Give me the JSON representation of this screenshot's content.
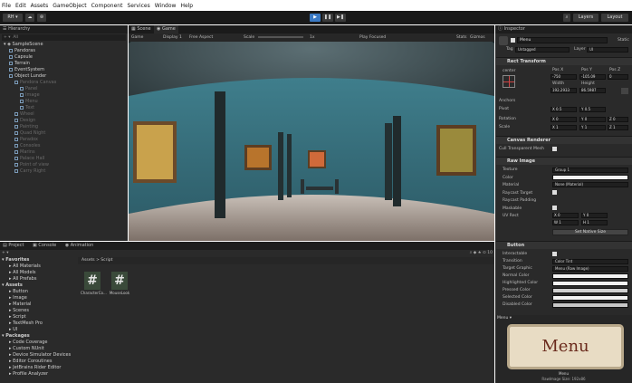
{
  "menubar": [
    "File",
    "Edit",
    "Assets",
    "GameObject",
    "Component",
    "Services",
    "Window",
    "Help"
  ],
  "toolbar": {
    "account": "RH ▾",
    "cloud": "☁",
    "play": "▶",
    "pause": "❚❚",
    "step": "▶❚",
    "layers": "Layers",
    "layout": "Layout"
  },
  "hierarchy": {
    "tab": "Hierarchy",
    "search_placeholder": "All",
    "scene": "SampleScene",
    "items": [
      {
        "label": "Pandoras",
        "dim": false
      },
      {
        "label": "Capsule",
        "dim": false
      },
      {
        "label": "Terrain",
        "dim": false
      },
      {
        "label": "EventSystem",
        "dim": false
      },
      {
        "label": "Object Lunder",
        "dim": false
      },
      {
        "label": "Pandora Canvas",
        "dim": true
      },
      {
        "label": "Panel",
        "dim": true
      },
      {
        "label": "Image",
        "dim": true
      },
      {
        "label": "Menu",
        "dim": true
      },
      {
        "label": "Text",
        "dim": true
      },
      {
        "label": "Wheel",
        "dim": true
      },
      {
        "label": "Design",
        "dim": true
      },
      {
        "label": "Painting",
        "dim": true
      },
      {
        "label": "Quad Night",
        "dim": true
      },
      {
        "label": "Paradox",
        "dim": true
      },
      {
        "label": "Consoles",
        "dim": true
      },
      {
        "label": "Marins",
        "dim": true
      },
      {
        "label": "Palace Hall",
        "dim": true
      },
      {
        "label": "Point of view",
        "dim": true
      },
      {
        "label": "Carry Right",
        "dim": true
      }
    ]
  },
  "scene_view": {
    "tabs": [
      "Scene",
      "Game"
    ],
    "game_bar": {
      "display": "Game",
      "display_no": "Display 1",
      "aspect": "Free Aspect",
      "scale": "Scale",
      "scale_value": "1x",
      "play_focused": "Play Focused",
      "stats": "Stats",
      "gizmos": "Gizmos"
    }
  },
  "project": {
    "tabs": [
      "Project",
      "Console",
      "Animation"
    ],
    "favorites_title": "Favorites",
    "favorites": [
      "All Materials",
      "All Models",
      "All Prefabs"
    ],
    "assets_title": "Assets",
    "assets": [
      "Button",
      "Image",
      "Material",
      "Scenes",
      "Script",
      "TextMesh Pro",
      "UI"
    ],
    "packages_title": "Packages",
    "packages": [
      "Code Coverage",
      "Custom NUnit",
      "Device Simulator Devices",
      "Editor Coroutines",
      "JetBrains Rider Editor",
      "Profile Analyzer"
    ],
    "breadcrumb": "Assets > Script",
    "files": [
      "CharacterCo...",
      "MouseLook"
    ],
    "file_icon": "#",
    "count_label": "10"
  },
  "inspector": {
    "tab": "Inspector",
    "object_name": "Menu",
    "static_label": "Static",
    "tag_label": "Tag",
    "tag_value": "Untagged",
    "layer_label": "Layer",
    "layer_value": "UI",
    "rect_transform": {
      "title": "Rect Transform",
      "anchor_label": "center",
      "pos_headers": [
        "Pos X",
        "Pos Y",
        "Pos Z"
      ],
      "pos_values": [
        "-750",
        "-105.09",
        "0"
      ],
      "size_headers": [
        "Width",
        "Height"
      ],
      "size_values": [
        "192.2933",
        "86.5987"
      ],
      "anchors_label": "Anchors",
      "pivot_label": "Pivot",
      "pivot_values": [
        "X 0.5",
        "Y 0.5"
      ],
      "rotation_label": "Rotation",
      "rotation_values": [
        "X 0",
        "Y 0",
        "Z 0"
      ],
      "scale_label": "Scale",
      "scale_values": [
        "X 1",
        "Y 1",
        "Z 1"
      ]
    },
    "canvas_renderer": {
      "title": "Canvas Renderer",
      "cull_label": "Cull Transparent Mesh"
    },
    "raw_image": {
      "title": "Raw Image",
      "rows": [
        "Texture",
        "Color",
        "Material",
        "Raycast Target",
        "Raycast Padding",
        "Maskable",
        "UV Rect"
      ],
      "texture_value": "Group 1",
      "material_value": "None (Material)",
      "uv_values": [
        "X 0",
        "Y 0",
        "W 1",
        "H 1"
      ],
      "native_size_btn": "Set Native Size"
    },
    "button": {
      "title": "Button",
      "rows": [
        "Interactable",
        "Transition",
        "Target Graphic",
        "Normal Color",
        "Highlighted Color",
        "Pressed Color",
        "Selected Color",
        "Disabled Color"
      ],
      "transition_value": "Color Tint",
      "target_value": "Menu (Raw Image)"
    },
    "preview": {
      "header": "Menu ▾",
      "label": "Menu",
      "caption_name": "Menu",
      "caption_size": "RawImage Size: 192x86"
    }
  },
  "colors": {
    "accent": "#3a79c4",
    "panel": "#2a2a2a",
    "header": "#1e1e1e",
    "wall": "#4a8c9a",
    "floor": "#a49a92",
    "menu_btn": "#e8dcc4",
    "menu_text": "#6a2a1c"
  }
}
